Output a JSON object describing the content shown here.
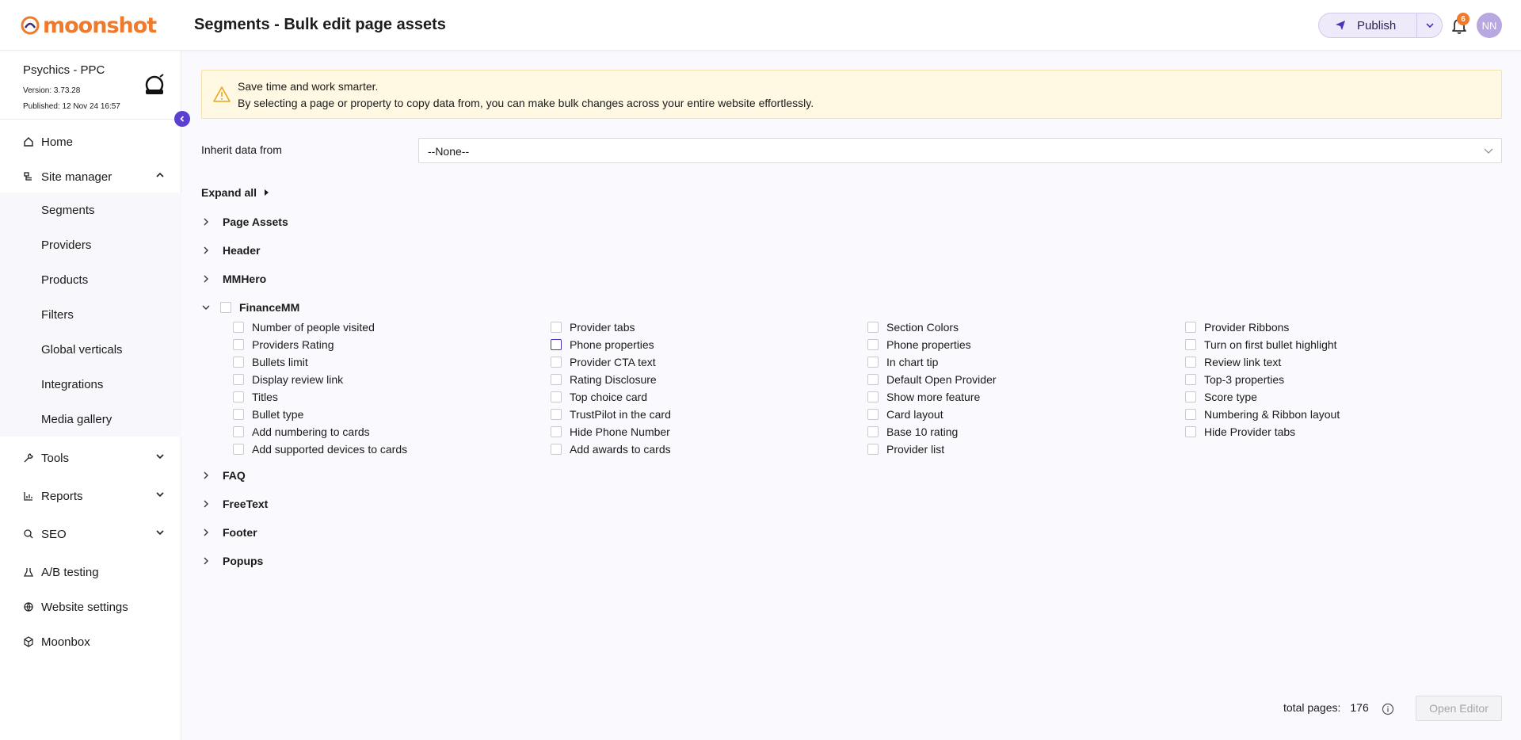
{
  "app": {
    "brand": "moonshot",
    "page_title": "Segments - Bulk edit page assets",
    "publish_label": "Publish",
    "notifications_count": "6",
    "user_initials": "NN",
    "brand_color": "#f07a2b",
    "accent_color": "#5a3fd0"
  },
  "site": {
    "name": "Psychics - PPC",
    "version": "Version: 3.73.28",
    "published": "Published: 12 Nov 24 16:57"
  },
  "sidebar": {
    "home": "Home",
    "site_manager": "Site manager",
    "site_manager_items": [
      "Segments",
      "Providers",
      "Products",
      "Filters",
      "Global verticals",
      "Integrations",
      "Media gallery"
    ],
    "tools": "Tools",
    "reports": "Reports",
    "seo": "SEO",
    "ab_testing": "A/B testing",
    "website_settings": "Website settings",
    "moonbox": "Moonbox"
  },
  "banner": {
    "line1": "Save time and work smarter.",
    "line2": "By selecting a page or property to copy data from, you can make bulk changes across your entire website effortlessly."
  },
  "inherit": {
    "label": "Inherit data from",
    "value": "--None--"
  },
  "expand_all": "Expand all",
  "sections": {
    "page_assets": "Page Assets",
    "header": "Header",
    "mmhero": "MMHero",
    "financemm": "FinanceMM",
    "faq": "FAQ",
    "freetext": "FreeText",
    "footer": "Footer",
    "popups": "Popups"
  },
  "financemm_props": {
    "col1": [
      "Number of people visited",
      "Providers Rating",
      "Bullets limit",
      "Display review link",
      "Titles",
      "Bullet type",
      "Add numbering to cards",
      "Add supported devices to cards"
    ],
    "col2": [
      "Provider tabs",
      "Phone properties",
      "Provider CTA text",
      "Rating Disclosure",
      "Top choice card",
      "TrustPilot in the card",
      "Hide Phone Number",
      "Add awards to cards"
    ],
    "col3": [
      "Section Colors",
      "Phone properties",
      "In chart tip",
      "Default Open Provider",
      "Show more feature",
      "Card layout",
      "Base 10 rating",
      "Provider list"
    ],
    "col4": [
      "Provider Ribbons",
      "Turn on first bullet highlight",
      "Review link text",
      "Top-3 properties",
      "Score type",
      "Numbering & Ribbon layout",
      "Hide Provider tabs"
    ]
  },
  "footer": {
    "total_label": "total pages:",
    "total_value": "176",
    "open_editor": "Open Editor"
  }
}
